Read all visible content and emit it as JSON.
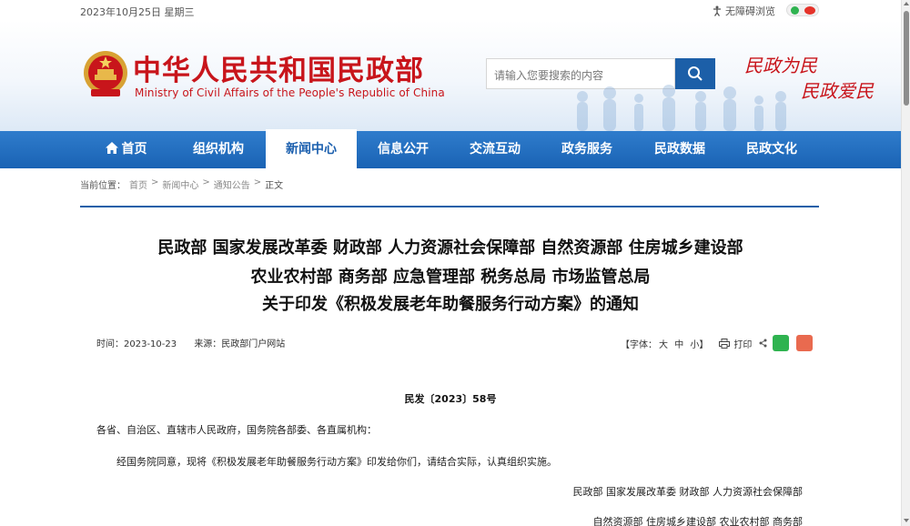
{
  "topbar": {
    "date": "2023年10月25日 星期三",
    "accessibility": "无障碍浏览"
  },
  "header": {
    "title": "中华人民共和国民政部",
    "subtitle": "Ministry of Civil Affairs of the People's Republic of China",
    "search_placeholder": "请输入您要搜索的内容",
    "slogan_1": "民政为民",
    "slogan_2": "民政爱民"
  },
  "nav": {
    "items": [
      {
        "label": "首页"
      },
      {
        "label": "组织机构"
      },
      {
        "label": "新闻中心"
      },
      {
        "label": "信息公开"
      },
      {
        "label": "交流互动"
      },
      {
        "label": "政务服务"
      },
      {
        "label": "民政数据"
      },
      {
        "label": "民政文化"
      }
    ],
    "active_index": 2
  },
  "breadcrumb": {
    "prefix": "当前位置：",
    "items": [
      "首页",
      "新闻中心",
      "通知公告",
      "正文"
    ]
  },
  "article": {
    "title_line_1": "民政部 国家发展改革委 财政部 人力资源社会保障部 自然资源部 住房城乡建设部",
    "title_line_2": "农业农村部 商务部 应急管理部 税务总局 市场监管总局",
    "title_line_3": "关于印发《积极发展老年助餐服务行动方案》的通知",
    "time": "时间：2023-10-23",
    "source": "来源：民政部门户网站",
    "font_label_open": "【字体：",
    "font_large": "大",
    "font_medium": "中",
    "font_small": "小】",
    "print": "打印",
    "doc_number": "民发〔2023〕58号",
    "addressee": "各省、自治区、直辖市人民政府，国务院各部委、各直属机构：",
    "body_1": "经国务院同意，现将《积极发展老年助餐服务行动方案》印发给你们，请结合实际，认真组织实施。",
    "signature_1": "民政部 国家发展改革委 财政部 人力资源社会保障部",
    "signature_2": "自然资源部 住房城乡建设部 农业农村部 商务部"
  },
  "colors": {
    "brand_red": "#c8151b",
    "nav_blue": "#1a63b4",
    "wechat_green": "#2fb350",
    "weibo_red": "#e96a4f"
  }
}
